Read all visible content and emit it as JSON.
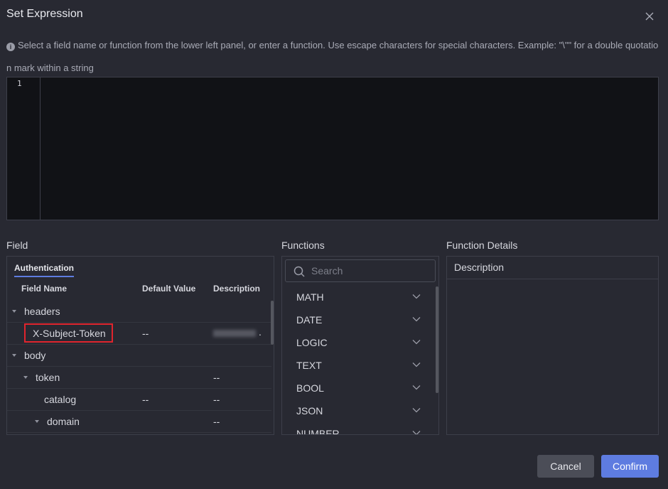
{
  "dialog": {
    "title": "Set Expression",
    "hint": "Select a field name or function from the lower left panel, or enter a function. Use escape characters for special characters. Example: \"\\\"\" for a double quotation mark within a string",
    "info_icon": "i"
  },
  "editor": {
    "line_number": "1",
    "content": ""
  },
  "field_panel": {
    "label": "Field",
    "tab": "Authentication",
    "columns": {
      "name": "Field Name",
      "default": "Default Value",
      "description": "Description"
    },
    "rows": [
      {
        "name": "headers",
        "default": "",
        "description": "",
        "expanded": true
      },
      {
        "name": "X-Subject-Token",
        "default": "--",
        "description": "",
        "highlighted": true
      },
      {
        "name": "body",
        "default": "",
        "description": "",
        "expanded": true
      },
      {
        "name": "token",
        "default": "",
        "description": "--",
        "expanded": true
      },
      {
        "name": "catalog",
        "default": "--",
        "description": "--"
      },
      {
        "name": "domain",
        "default": "",
        "description": "--",
        "expanded": true
      }
    ],
    "blurred_description_trailing": "."
  },
  "functions_panel": {
    "label": "Functions",
    "search_placeholder": "Search",
    "items": [
      "MATH",
      "DATE",
      "LOGIC",
      "TEXT",
      "BOOL",
      "JSON",
      "NUMBER"
    ]
  },
  "details_panel": {
    "label": "Function Details",
    "header": "Description"
  },
  "buttons": {
    "cancel": "Cancel",
    "confirm": "Confirm"
  },
  "colors": {
    "background": "#282932",
    "editor_bg": "#111216",
    "accent": "#5e7ce0",
    "highlight_border": "#e0242d"
  },
  "icons": {
    "close": "close-icon",
    "info": "info-icon",
    "search": "search-icon",
    "expand": "chevron-down-icon",
    "tree": "caret-down-icon"
  }
}
